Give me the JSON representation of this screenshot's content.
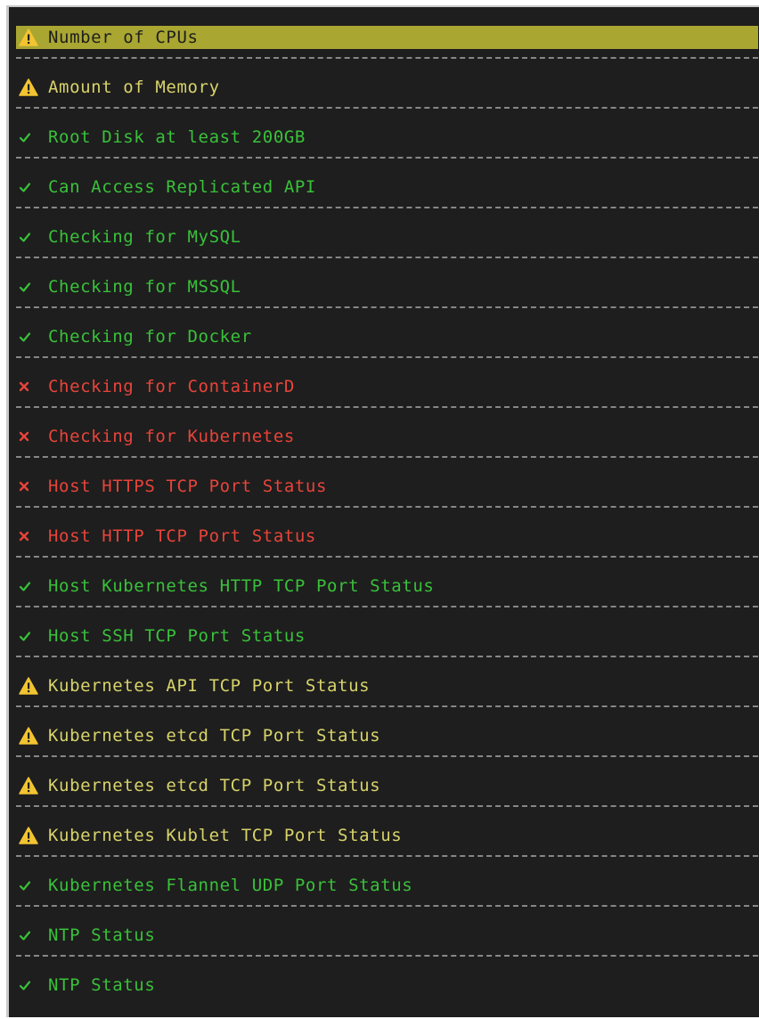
{
  "colors": {
    "warn": "#d8d36a",
    "pass": "#39c13a",
    "fail": "#e8443a",
    "selected_bg": "#a9a632",
    "background": "#1e1e1e"
  },
  "checks": [
    {
      "label": "Number of CPUs",
      "status": "warn",
      "icon": "warning-icon",
      "selected": true
    },
    {
      "label": "Amount of Memory",
      "status": "warn",
      "icon": "warning-icon"
    },
    {
      "label": "Root Disk at least 200GB",
      "status": "pass",
      "icon": "checkmark-icon"
    },
    {
      "label": "Can Access Replicated API",
      "status": "pass",
      "icon": "checkmark-icon"
    },
    {
      "label": "Checking for MySQL",
      "status": "pass",
      "icon": "checkmark-icon"
    },
    {
      "label": "Checking for MSSQL",
      "status": "pass",
      "icon": "checkmark-icon"
    },
    {
      "label": "Checking for Docker",
      "status": "pass",
      "icon": "checkmark-icon"
    },
    {
      "label": "Checking for ContainerD",
      "status": "fail",
      "icon": "cross-icon"
    },
    {
      "label": "Checking for Kubernetes",
      "status": "fail",
      "icon": "cross-icon"
    },
    {
      "label": "Host HTTPS TCP Port Status",
      "status": "fail",
      "icon": "cross-icon"
    },
    {
      "label": "Host HTTP TCP Port Status",
      "status": "fail",
      "icon": "cross-icon"
    },
    {
      "label": "Host Kubernetes HTTP TCP Port Status",
      "status": "pass",
      "icon": "checkmark-icon"
    },
    {
      "label": "Host SSH TCP Port Status",
      "status": "pass",
      "icon": "checkmark-icon"
    },
    {
      "label": "Kubernetes API TCP Port Status",
      "status": "warn",
      "icon": "warning-icon"
    },
    {
      "label": "Kubernetes etcd TCP Port Status",
      "status": "warn",
      "icon": "warning-icon"
    },
    {
      "label": "Kubernetes etcd TCP Port Status",
      "status": "warn",
      "icon": "warning-icon"
    },
    {
      "label": "Kubernetes Kublet TCP Port Status",
      "status": "warn",
      "icon": "warning-icon"
    },
    {
      "label": "Kubernetes Flannel UDP Port Status",
      "status": "pass",
      "icon": "checkmark-icon"
    },
    {
      "label": "NTP Status",
      "status": "pass",
      "icon": "checkmark-icon"
    },
    {
      "label": "NTP Status",
      "status": "pass",
      "icon": "checkmark-icon"
    }
  ]
}
